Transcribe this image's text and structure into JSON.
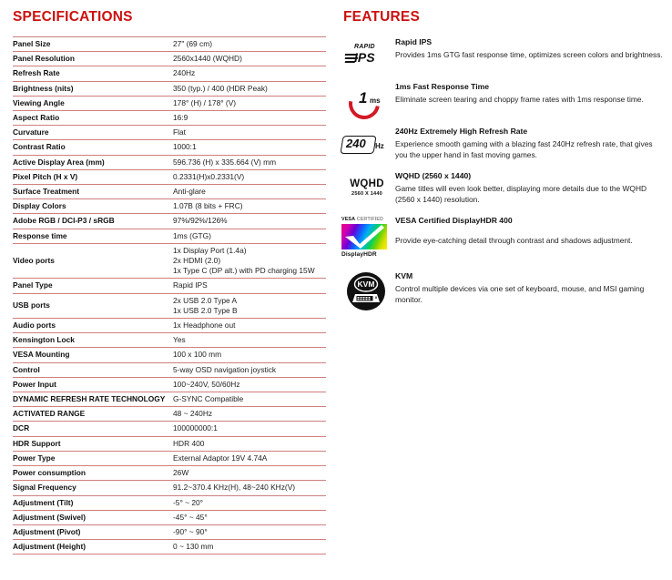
{
  "specifications": {
    "title": "SPECIFICATIONS",
    "rows": [
      {
        "label": "Panel Size",
        "value": "27\" (69 cm)"
      },
      {
        "label": "Panel Resolution",
        "value": "2560x1440 (WQHD)"
      },
      {
        "label": "Refresh Rate",
        "value": "240Hz"
      },
      {
        "label": "Brightness (nits)",
        "value": "350 (typ.) / 400 (HDR Peak)"
      },
      {
        "label": "Viewing Angle",
        "value": "178° (H) / 178° (V)"
      },
      {
        "label": "Aspect Ratio",
        "value": "16:9"
      },
      {
        "label": "Curvature",
        "value": "Flat"
      },
      {
        "label": "Contrast Ratio",
        "value": "1000:1"
      },
      {
        "label": "Active Display Area (mm)",
        "value": "596.736 (H) x 335.664 (V) mm"
      },
      {
        "label": "Pixel Pitch (H x V)",
        "value": "0.2331(H)x0.2331(V)"
      },
      {
        "label": "Surface Treatment",
        "value": "Anti-glare"
      },
      {
        "label": "Display Colors",
        "value": "1.07B (8 bits + FRC)"
      },
      {
        "label": "Adobe RGB / DCI-P3 / sRGB",
        "value": "97%/92%/126%"
      },
      {
        "label": "Response time",
        "value": "1ms (GTG)"
      },
      {
        "label": "Video ports",
        "value": "1x Display Port (1.4a)\n2x HDMI (2.0)\n1x Type C (DP alt.) with PD charging 15W"
      },
      {
        "label": "Panel Type",
        "value": "Rapid IPS"
      },
      {
        "label": "USB ports",
        "value": "2x USB 2.0 Type A\n1x USB 2.0 Type B"
      },
      {
        "label": "Audio ports",
        "value": "1x Headphone out"
      },
      {
        "label": "Kensington Lock",
        "value": "Yes"
      },
      {
        "label": "VESA Mounting",
        "value": "100 x 100 mm"
      },
      {
        "label": "Control",
        "value": "5-way OSD navigation joystick"
      },
      {
        "label": "Power Input",
        "value": "100~240V, 50/60Hz"
      },
      {
        "label": "DYNAMIC REFRESH RATE TECHNOLOGY",
        "value": "G-SYNC Compatible"
      },
      {
        "label": "ACTIVATED RANGE",
        "value": "48 ~ 240Hz"
      },
      {
        "label": "DCR",
        "value": "100000000:1"
      },
      {
        "label": "HDR Support",
        "value": "HDR 400"
      },
      {
        "label": "Power Type",
        "value": "External Adaptor 19V 4.74A"
      },
      {
        "label": "Power consumption",
        "value": "26W"
      },
      {
        "label": "Signal Frequency",
        "value": "91.2~370.4 KHz(H), 48~240 KHz(V)"
      },
      {
        "label": "Adjustment (Tilt)",
        "value": "-5° ~ 20°"
      },
      {
        "label": "Adjustment (Swivel)",
        "value": "-45° ~ 45°"
      },
      {
        "label": "Adjustment (Pivot)",
        "value": "-90° ~ 90°"
      },
      {
        "label": "Adjustment (Height)",
        "value": "0 ~ 130 mm"
      }
    ]
  },
  "features": {
    "title": "FEATURES",
    "items": [
      {
        "icon": "rapid-ips-icon",
        "icon_text": {
          "top": "RAPID",
          "main": "IPS"
        },
        "heading": "Rapid IPS",
        "body": "Provides 1ms GTG fast response time, optimizes screen colors and brightness."
      },
      {
        "icon": "one-ms-response-icon",
        "icon_text": {
          "number": "1",
          "unit": "ms"
        },
        "heading": "1ms Fast Response Time",
        "body": "Eliminate screen tearing and choppy frame rates with 1ms response time."
      },
      {
        "icon": "refresh-rate-240hz-icon",
        "icon_text": {
          "number": "240",
          "unit": "Hz"
        },
        "heading": "240Hz Extremely High Refresh Rate",
        "body": "Experience smooth gaming with a blazing fast 240Hz refresh rate, that gives you the upper hand in fast moving games."
      },
      {
        "icon": "wqhd-icon",
        "icon_text": {
          "main": "WQHD",
          "sub": "2560 X 1440"
        },
        "heading": "WQHD (2560 x 1440)",
        "body": "Game titles will even look better, displaying more details due to the WQHD (2560 x 1440) resolution."
      },
      {
        "icon": "vesa-displayhdr-icon",
        "icon_text": {
          "top_bold": "VESA",
          "top_light": "CERTIFIED",
          "bottom": "DisplayHDR"
        },
        "heading": "VESA Certified DisplayHDR 400",
        "body": "Provide eye-catching detail through contrast and  shadows adjustment."
      },
      {
        "icon": "kvm-icon",
        "icon_text": {
          "main": "KVM"
        },
        "heading": "KVM",
        "body": "Control multiple devices via one set of keyboard, mouse, and MSI gaming monitor."
      }
    ]
  },
  "colors": {
    "heading_red": "#cc1111",
    "rule_line": "#cf7f7f",
    "accent_red": "#d21a26",
    "text": "#1a1a1a",
    "background": "#ffffff"
  }
}
